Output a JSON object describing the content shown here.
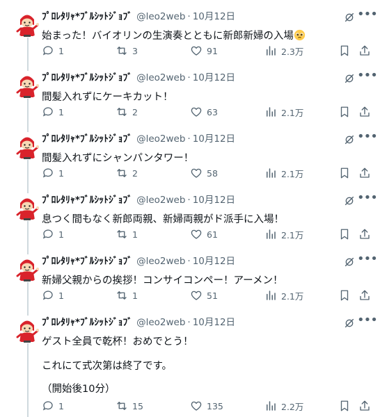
{
  "colors": {
    "text": "#0f1419",
    "secondary": "#536471",
    "thread_line": "#cfd9de",
    "avatar_red": "#d9232b"
  },
  "author": {
    "name": "ﾌﾟﾛﾚﾀﾘｬ*ﾌﾞﾙｼｯﾄｼﾞｮﾌﾞ",
    "handle": "@leo2web",
    "separator": "·"
  },
  "tweets": [
    {
      "date": "10月12日",
      "lines": [
        "始まった！バイオリンの生演奏とともに新郎新婦の入場"
      ],
      "emoji": "pleading-face",
      "replies": "1",
      "reposts": "3",
      "likes": "91",
      "views": "2.3万"
    },
    {
      "date": "10月12日",
      "lines": [
        "間髪入れずにケーキカット！"
      ],
      "replies": "1",
      "reposts": "2",
      "likes": "63",
      "views": "2.1万"
    },
    {
      "date": "10月12日",
      "lines": [
        "間髪入れずにシャンパンタワー！"
      ],
      "replies": "1",
      "reposts": "2",
      "likes": "58",
      "views": "2.1万"
    },
    {
      "date": "10月12日",
      "lines": [
        "息つく間もなく新郎両親、新婦両親がド派手に入場！"
      ],
      "replies": "1",
      "reposts": "1",
      "likes": "61",
      "views": "2.1万"
    },
    {
      "date": "10月12日",
      "lines": [
        "新婦父親からの挨拶！コンサイコンペー！アーメン！"
      ],
      "replies": "1",
      "reposts": "1",
      "likes": "51",
      "views": "2.1万"
    },
    {
      "date": "10月12日",
      "lines": [
        "ゲスト全員で乾杯！おめでとう！",
        "これにて式次第は終了です。",
        "（開始後10分）"
      ],
      "replies": "1",
      "reposts": "15",
      "likes": "135",
      "views": "2.2万"
    }
  ]
}
